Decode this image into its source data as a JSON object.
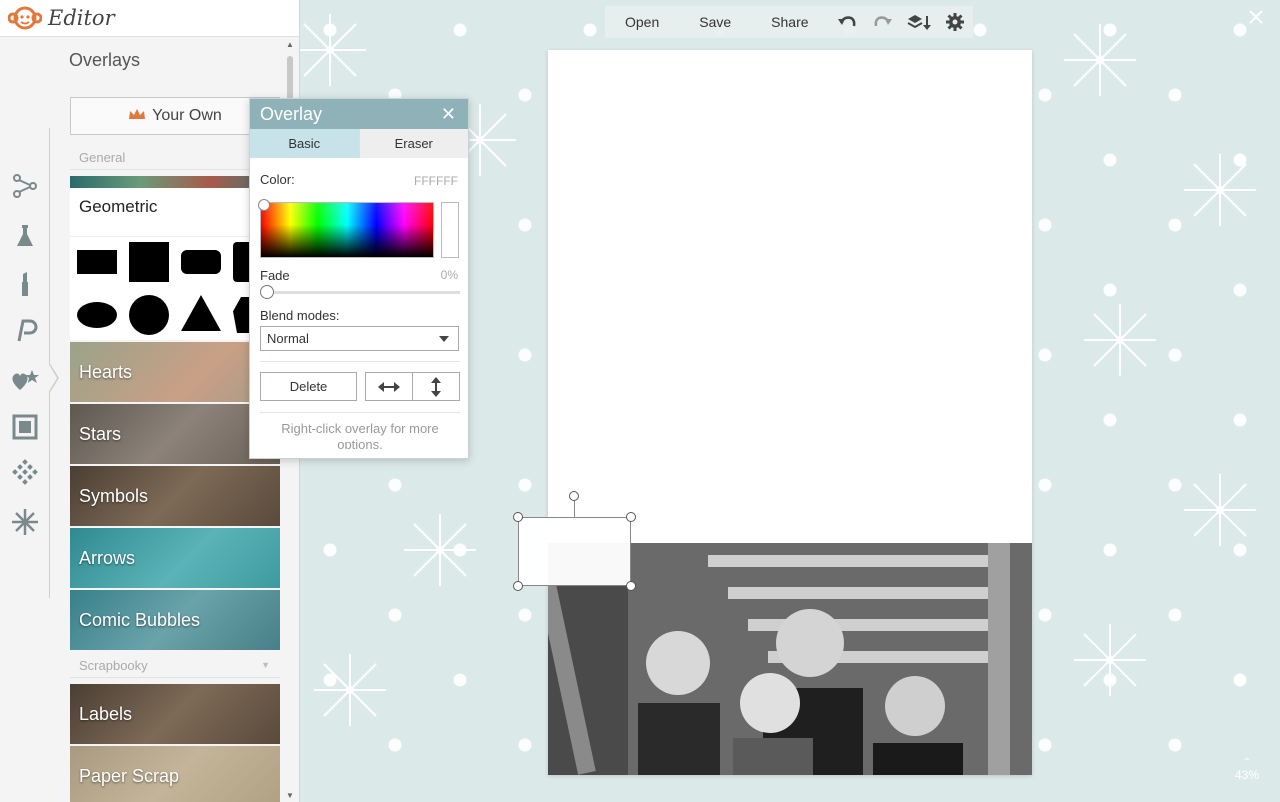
{
  "app": {
    "title": "Editor",
    "brand_color": "#e07a3c"
  },
  "sidebar": {
    "panel_title": "Overlays",
    "rail_icons": [
      "effects-icon",
      "touch-up-icon",
      "text-icon",
      "overlays-icon",
      "frames-icon",
      "textures-icon",
      "themes-icon"
    ],
    "your_own_label": "Your Own",
    "general_label": "General",
    "scrapbooky_label": "Scrapbooky",
    "geometric_title": "Geometric",
    "categories": [
      {
        "label": "Hearts",
        "color": "#b9a089"
      },
      {
        "label": "Stars",
        "color": "#7b7269"
      },
      {
        "label": "Symbols",
        "color": "#6b5a4a"
      },
      {
        "label": "Arrows",
        "color": "#3f9ea3"
      },
      {
        "label": "Comic Bubbles",
        "color": "#4a8d95"
      }
    ],
    "scrapbook_categories": [
      {
        "label": "Labels",
        "color": "#6b5a4a"
      },
      {
        "label": "Paper Scrap",
        "color": "#b3a387"
      }
    ]
  },
  "toolbar": {
    "open_label": "Open",
    "save_label": "Save",
    "share_label": "Share"
  },
  "dialog": {
    "title": "Overlay",
    "tab_basic": "Basic",
    "tab_eraser": "Eraser",
    "color_label": "Color:",
    "color_value": "FFFFFF",
    "fade_label": "Fade",
    "fade_value": "0%",
    "blend_label": "Blend modes:",
    "blend_value": "Normal",
    "delete_label": "Delete",
    "hint": "Right-click overlay for more options."
  },
  "canvas": {
    "zoom_label": "43%"
  }
}
